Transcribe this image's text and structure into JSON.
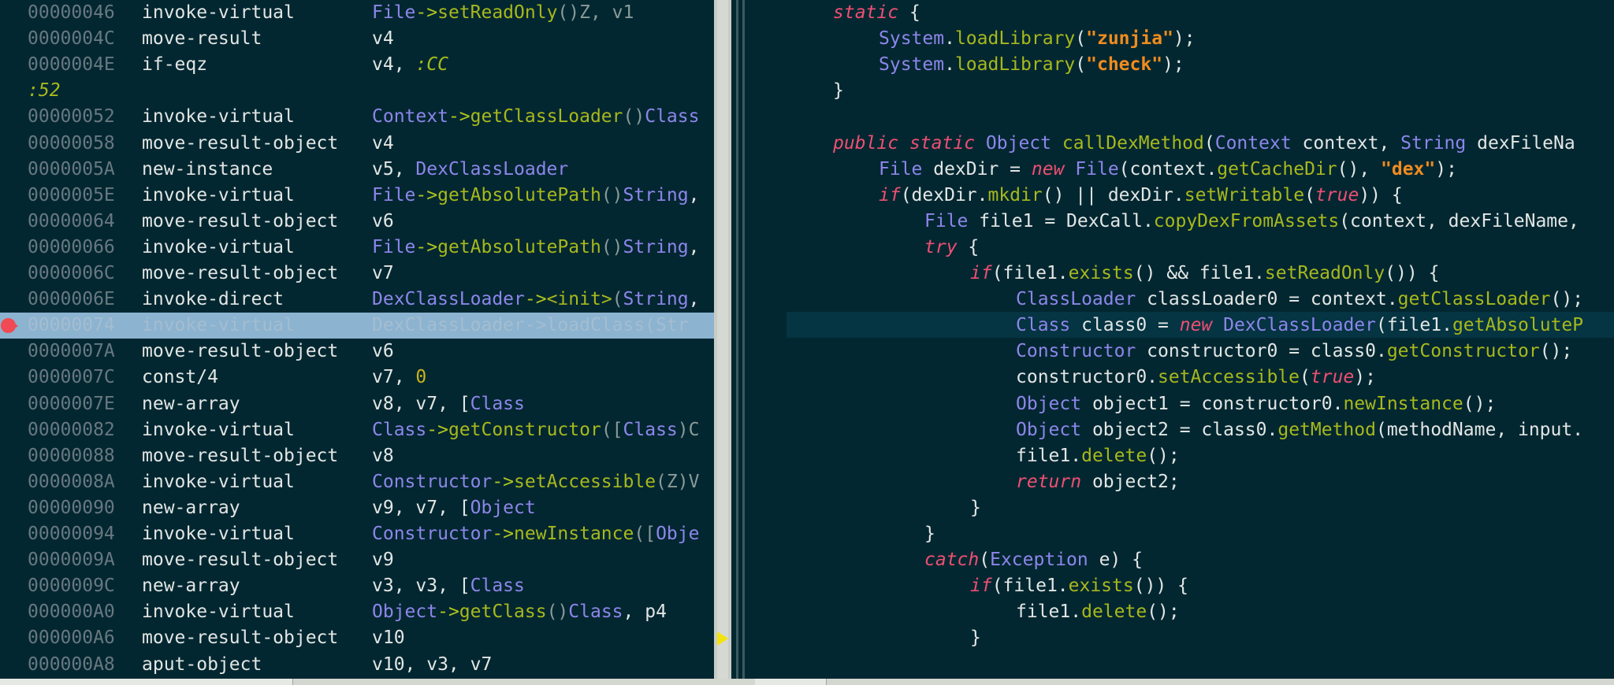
{
  "disassembly": {
    "rows": [
      {
        "kind": "code",
        "addr": "00000046",
        "instr": "invoke-virtual",
        "args": [
          [
            "File",
            "cls"
          ],
          [
            "->",
            "arrow"
          ],
          [
            "setReadOnly",
            "mth"
          ],
          [
            "()Z, v1",
            "dim"
          ]
        ]
      },
      {
        "kind": "code",
        "addr": "0000004C",
        "instr": "move-result",
        "args": [
          [
            "v4",
            "plain"
          ]
        ]
      },
      {
        "kind": "code",
        "addr": "0000004E",
        "instr": "if-eqz",
        "args": [
          [
            "v4, ",
            "plain"
          ],
          [
            ":CC",
            "lbl"
          ]
        ]
      },
      {
        "kind": "label",
        "text": ":52"
      },
      {
        "kind": "code",
        "addr": "00000052",
        "instr": "invoke-virtual",
        "args": [
          [
            "Context",
            "cls"
          ],
          [
            "->",
            "arrow"
          ],
          [
            "getClassLoader",
            "mth"
          ],
          [
            "()",
            "dim"
          ],
          [
            "Class",
            "cls"
          ]
        ]
      },
      {
        "kind": "code",
        "addr": "00000058",
        "instr": "move-result-object",
        "args": [
          [
            "v4",
            "plain"
          ]
        ]
      },
      {
        "kind": "code",
        "addr": "0000005A",
        "instr": "new-instance",
        "args": [
          [
            "v5, ",
            "plain"
          ],
          [
            "DexClassLoader",
            "cls"
          ]
        ]
      },
      {
        "kind": "code",
        "addr": "0000005E",
        "instr": "invoke-virtual",
        "args": [
          [
            "File",
            "cls"
          ],
          [
            "->",
            "arrow"
          ],
          [
            "getAbsolutePath",
            "mth"
          ],
          [
            "()",
            "dim"
          ],
          [
            "String",
            "cls"
          ],
          [
            ",",
            "plain"
          ]
        ]
      },
      {
        "kind": "code",
        "addr": "00000064",
        "instr": "move-result-object",
        "args": [
          [
            "v6",
            "plain"
          ]
        ]
      },
      {
        "kind": "code",
        "addr": "00000066",
        "instr": "invoke-virtual",
        "args": [
          [
            "File",
            "cls"
          ],
          [
            "->",
            "arrow"
          ],
          [
            "getAbsolutePath",
            "mth"
          ],
          [
            "()",
            "dim"
          ],
          [
            "String",
            "cls"
          ],
          [
            ",",
            "plain"
          ]
        ]
      },
      {
        "kind": "code",
        "addr": "0000006C",
        "instr": "move-result-object",
        "args": [
          [
            "v7",
            "plain"
          ]
        ]
      },
      {
        "kind": "code",
        "addr": "0000006E",
        "instr": "invoke-direct",
        "args": [
          [
            "DexClassLoader",
            "cls"
          ],
          [
            "->",
            "arrow"
          ],
          [
            "<init>",
            "mth"
          ],
          [
            "(",
            "dim"
          ],
          [
            "String",
            "cls"
          ],
          [
            ",",
            "plain"
          ]
        ]
      },
      {
        "kind": "code",
        "addr": "00000074",
        "instr": "invoke-virtual",
        "selected": true,
        "breakpoint": true,
        "args": [
          [
            "DexClassLoader->loadClass(Str",
            "plain"
          ]
        ]
      },
      {
        "kind": "code",
        "addr": "0000007A",
        "instr": "move-result-object",
        "args": [
          [
            "v6",
            "plain"
          ]
        ]
      },
      {
        "kind": "code",
        "addr": "0000007C",
        "instr": "const/4",
        "args": [
          [
            "v7, ",
            "plain"
          ],
          [
            "0",
            "num"
          ]
        ]
      },
      {
        "kind": "code",
        "addr": "0000007E",
        "instr": "new-array",
        "args": [
          [
            "v8, v7, [",
            "plain"
          ],
          [
            "Class",
            "cls"
          ]
        ]
      },
      {
        "kind": "code",
        "addr": "00000082",
        "instr": "invoke-virtual",
        "args": [
          [
            "Class",
            "cls"
          ],
          [
            "->",
            "arrow"
          ],
          [
            "getConstructor",
            "mth"
          ],
          [
            "([",
            "dim"
          ],
          [
            "Class",
            "cls"
          ],
          [
            ")C",
            "dim"
          ]
        ]
      },
      {
        "kind": "code",
        "addr": "00000088",
        "instr": "move-result-object",
        "args": [
          [
            "v8",
            "plain"
          ]
        ]
      },
      {
        "kind": "code",
        "addr": "0000008A",
        "instr": "invoke-virtual",
        "args": [
          [
            "Constructor",
            "cls"
          ],
          [
            "->",
            "arrow"
          ],
          [
            "setAccessible",
            "mth"
          ],
          [
            "(Z)V",
            "dim"
          ]
        ]
      },
      {
        "kind": "code",
        "addr": "00000090",
        "instr": "new-array",
        "args": [
          [
            "v9, v7, [",
            "plain"
          ],
          [
            "Object",
            "cls"
          ]
        ]
      },
      {
        "kind": "code",
        "addr": "00000094",
        "instr": "invoke-virtual",
        "args": [
          [
            "Constructor",
            "cls"
          ],
          [
            "->",
            "arrow"
          ],
          [
            "newInstance",
            "mth"
          ],
          [
            "([",
            "dim"
          ],
          [
            "Obje",
            "cls"
          ]
        ]
      },
      {
        "kind": "code",
        "addr": "0000009A",
        "instr": "move-result-object",
        "args": [
          [
            "v9",
            "plain"
          ]
        ]
      },
      {
        "kind": "code",
        "addr": "0000009C",
        "instr": "new-array",
        "args": [
          [
            "v3, v3, [",
            "plain"
          ],
          [
            "Class",
            "cls"
          ]
        ]
      },
      {
        "kind": "code",
        "addr": "000000A0",
        "instr": "invoke-virtual",
        "args": [
          [
            "Object",
            "cls"
          ],
          [
            "->",
            "arrow"
          ],
          [
            "getClass",
            "mth"
          ],
          [
            "()",
            "dim"
          ],
          [
            "Class",
            "cls"
          ],
          [
            ", p4",
            "plain"
          ]
        ]
      },
      {
        "kind": "code",
        "addr": "000000A6",
        "instr": "move-result-object",
        "args": [
          [
            "v10",
            "plain"
          ]
        ]
      },
      {
        "kind": "code",
        "addr": "000000A8",
        "instr": "aput-object",
        "args": [
          [
            "v10, v3, v7",
            "plain"
          ]
        ]
      }
    ]
  },
  "java": {
    "lines": [
      {
        "indent": 0,
        "tokens": [
          [
            "static",
            "kw"
          ],
          [
            " {",
            "plain"
          ]
        ]
      },
      {
        "indent": 1,
        "tokens": [
          [
            "System",
            "type"
          ],
          [
            ".",
            "plain"
          ],
          [
            "loadLibrary",
            "mth"
          ],
          [
            "(",
            "plain"
          ],
          [
            "\"zunjia\"",
            "str"
          ],
          [
            ");",
            "plain"
          ]
        ]
      },
      {
        "indent": 1,
        "tokens": [
          [
            "System",
            "type"
          ],
          [
            ".",
            "plain"
          ],
          [
            "loadLibrary",
            "mth"
          ],
          [
            "(",
            "plain"
          ],
          [
            "\"check\"",
            "str"
          ],
          [
            ");",
            "plain"
          ]
        ]
      },
      {
        "indent": 0,
        "tokens": [
          [
            "}",
            "plain"
          ]
        ]
      },
      {
        "indent": 0,
        "tokens": []
      },
      {
        "indent": 0,
        "tokens": [
          [
            "public",
            "kw"
          ],
          [
            " ",
            "plain"
          ],
          [
            "static",
            "kw"
          ],
          [
            " ",
            "plain"
          ],
          [
            "Object",
            "type"
          ],
          [
            " ",
            "plain"
          ],
          [
            "callDexMethod",
            "mth"
          ],
          [
            "(",
            "plain"
          ],
          [
            "Context",
            "type"
          ],
          [
            " context, ",
            "plain"
          ],
          [
            "String",
            "type"
          ],
          [
            " dexFileNa",
            "plain"
          ]
        ]
      },
      {
        "indent": 1,
        "tokens": [
          [
            "File",
            "type"
          ],
          [
            " dexDir = ",
            "plain"
          ],
          [
            "new",
            "kw"
          ],
          [
            " ",
            "plain"
          ],
          [
            "File",
            "type"
          ],
          [
            "(context.",
            "plain"
          ],
          [
            "getCacheDir",
            "mth"
          ],
          [
            "(), ",
            "plain"
          ],
          [
            "\"dex\"",
            "str"
          ],
          [
            ");",
            "plain"
          ]
        ]
      },
      {
        "indent": 1,
        "tokens": [
          [
            "if",
            "kw"
          ],
          [
            "(dexDir.",
            "plain"
          ],
          [
            "mkdir",
            "mth"
          ],
          [
            "() || dexDir.",
            "plain"
          ],
          [
            "setWritable",
            "mth"
          ],
          [
            "(",
            "plain"
          ],
          [
            "true",
            "kw"
          ],
          [
            ")) {",
            "plain"
          ]
        ]
      },
      {
        "indent": 2,
        "tokens": [
          [
            "File",
            "type"
          ],
          [
            " file1 = DexCall.",
            "plain"
          ],
          [
            "copyDexFromAssets",
            "mth"
          ],
          [
            "(context, dexFileName,",
            "plain"
          ]
        ]
      },
      {
        "indent": 2,
        "tokens": [
          [
            "try",
            "kw"
          ],
          [
            " {",
            "plain"
          ]
        ]
      },
      {
        "indent": 3,
        "tokens": [
          [
            "if",
            "kw"
          ],
          [
            "(file1.",
            "plain"
          ],
          [
            "exists",
            "mth"
          ],
          [
            "() && file1.",
            "plain"
          ],
          [
            "setReadOnly",
            "mth"
          ],
          [
            "()) {",
            "plain"
          ]
        ]
      },
      {
        "indent": 4,
        "tokens": [
          [
            "ClassLoader",
            "type"
          ],
          [
            " classLoader0 = context.",
            "plain"
          ],
          [
            "getClassLoader",
            "mth"
          ],
          [
            "();",
            "plain"
          ]
        ]
      },
      {
        "indent": 4,
        "current": true,
        "tokens": [
          [
            "Class",
            "type"
          ],
          [
            " class0 = ",
            "plain"
          ],
          [
            "new",
            "kw"
          ],
          [
            " ",
            "plain"
          ],
          [
            "DexClassLoader",
            "type"
          ],
          [
            "(file1.",
            "plain"
          ],
          [
            "getAbsoluteP",
            "mth"
          ]
        ]
      },
      {
        "indent": 4,
        "tokens": [
          [
            "Constructor",
            "type"
          ],
          [
            " constructor0 = class0.",
            "plain"
          ],
          [
            "getConstructor",
            "mth"
          ],
          [
            "();",
            "plain"
          ]
        ]
      },
      {
        "indent": 4,
        "tokens": [
          [
            "constructor0.",
            "plain"
          ],
          [
            "setAccessible",
            "mth"
          ],
          [
            "(",
            "plain"
          ],
          [
            "true",
            "kw"
          ],
          [
            ");",
            "plain"
          ]
        ]
      },
      {
        "indent": 4,
        "tokens": [
          [
            "Object",
            "type"
          ],
          [
            " object1 = constructor0.",
            "plain"
          ],
          [
            "newInstance",
            "mth"
          ],
          [
            "();",
            "plain"
          ]
        ]
      },
      {
        "indent": 4,
        "tokens": [
          [
            "Object",
            "type"
          ],
          [
            " object2 = class0.",
            "plain"
          ],
          [
            "getMethod",
            "mth"
          ],
          [
            "(methodName, input.",
            "plain"
          ]
        ]
      },
      {
        "indent": 4,
        "tokens": [
          [
            "file1.",
            "plain"
          ],
          [
            "delete",
            "mth"
          ],
          [
            "();",
            "plain"
          ]
        ]
      },
      {
        "indent": 4,
        "tokens": [
          [
            "return",
            "kw"
          ],
          [
            " object2;",
            "plain"
          ]
        ]
      },
      {
        "indent": 3,
        "tokens": [
          [
            "}",
            "plain"
          ]
        ]
      },
      {
        "indent": 2,
        "tokens": [
          [
            "}",
            "plain"
          ]
        ]
      },
      {
        "indent": 2,
        "tokens": [
          [
            "catch",
            "kw"
          ],
          [
            "(",
            "plain"
          ],
          [
            "Exception",
            "type"
          ],
          [
            " e) {",
            "plain"
          ]
        ]
      },
      {
        "indent": 3,
        "tokens": [
          [
            "if",
            "kw"
          ],
          [
            "(file1.",
            "plain"
          ],
          [
            "exists",
            "mth"
          ],
          [
            "()) {",
            "plain"
          ]
        ]
      },
      {
        "indent": 4,
        "tokens": [
          [
            "file1.",
            "plain"
          ],
          [
            "delete",
            "mth"
          ],
          [
            "();",
            "plain"
          ]
        ]
      },
      {
        "indent": 3,
        "tokens": [
          [
            "}",
            "plain"
          ]
        ]
      }
    ]
  },
  "icons": {
    "breakpoint": "breakpoint-icon",
    "execution_pointer": "execution-pointer-icon"
  },
  "colors": {
    "background": "#032731",
    "selection": "#8cb3d0",
    "breakpoint": "#f04a55",
    "keyword": "#ee4f72",
    "type": "#8d86ea",
    "method": "#a7b81c",
    "string": "#f08c1e",
    "number": "#c9b41c"
  }
}
